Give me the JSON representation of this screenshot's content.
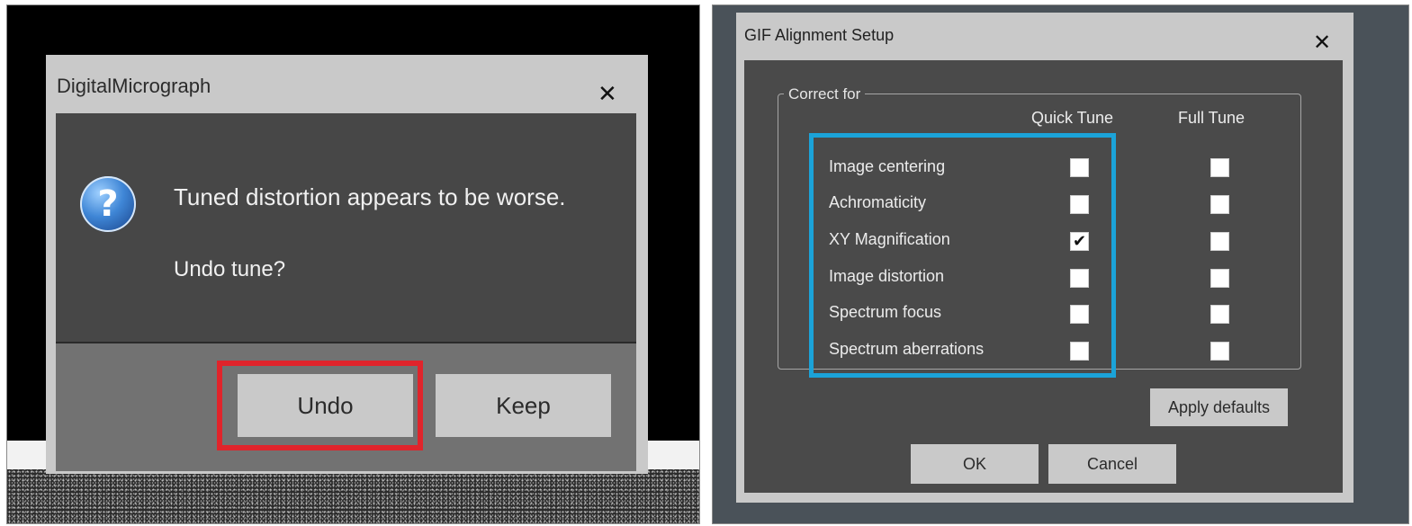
{
  "left": {
    "dialog": {
      "title": "DigitalMicrograph",
      "close_glyph": "✕",
      "icon": "question-icon",
      "icon_glyph": "?",
      "message": "Tuned distortion appears to be worse.",
      "question": "Undo tune?",
      "undo_label": "Undo",
      "keep_label": "Keep",
      "highlight_color": "#e0242b"
    }
  },
  "right": {
    "dialog": {
      "title": "GIF Alignment Setup",
      "close_glyph": "✕",
      "group_label": "Correct for",
      "columns": [
        "Quick Tune",
        "Full Tune"
      ],
      "rows": [
        {
          "label": "Image centering",
          "quick": false,
          "full": false
        },
        {
          "label": "Achromaticity",
          "quick": false,
          "full": false
        },
        {
          "label": "XY Magnification",
          "quick": true,
          "full": false
        },
        {
          "label": "Image distortion",
          "quick": false,
          "full": false
        },
        {
          "label": "Spectrum focus",
          "quick": false,
          "full": false
        },
        {
          "label": "Spectrum aberrations",
          "quick": false,
          "full": false
        }
      ],
      "check_glyph": "✔",
      "apply_defaults_label": "Apply defaults",
      "ok_label": "OK",
      "cancel_label": "Cancel",
      "highlight_color": "#1ba3d9"
    }
  }
}
